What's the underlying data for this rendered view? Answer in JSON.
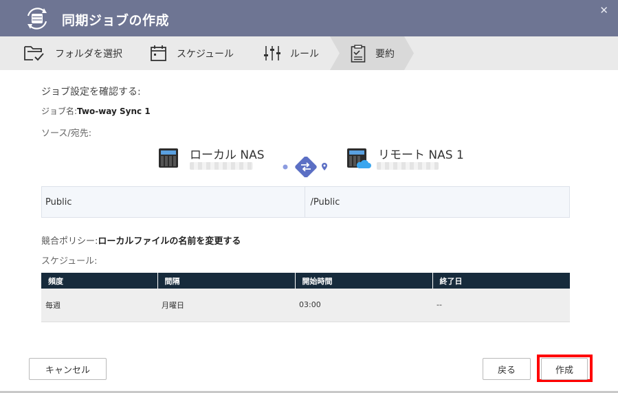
{
  "window": {
    "title": "同期ジョブの作成",
    "close_glyph": "✕"
  },
  "steps": [
    {
      "label": "フォルダを選択",
      "icon": "folder-check-icon"
    },
    {
      "label": "スケジュール",
      "icon": "calendar-icon"
    },
    {
      "label": "ルール",
      "icon": "sliders-icon"
    },
    {
      "label": "要約",
      "icon": "clipboard-icon",
      "active": true
    }
  ],
  "summary": {
    "heading": "ジョブ設定を確認する:",
    "job_name_label": "ジョブ名:",
    "job_name_value": "Two-way Sync 1",
    "source_dest_label": "ソース/宛先:",
    "local_name": "ローカル NAS",
    "remote_name": "リモート NAS 1",
    "local_path": "Public",
    "remote_path": "/Public",
    "conflict_label": "競合ポリシー:",
    "conflict_value": "ローカルファイルの名前を変更する",
    "schedule_label": "スケジュール:"
  },
  "schedule_table": {
    "headers": [
      "頻度",
      "間隔",
      "開始時間",
      "終了日"
    ],
    "rows": [
      [
        "毎週",
        "月曜日",
        "03:00",
        "--"
      ]
    ]
  },
  "buttons": {
    "cancel": "キャンセル",
    "back": "戻る",
    "create": "作成"
  },
  "colors": {
    "titlebar": "#6e7593",
    "step_active": "#d9d9d9",
    "table_header": "#172b3c",
    "highlight": "#ff0000",
    "sync_icon": "#5b6fc4"
  }
}
